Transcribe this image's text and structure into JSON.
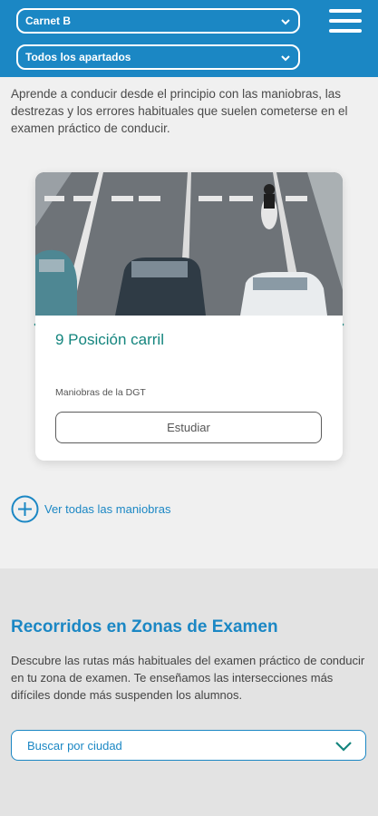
{
  "header": {
    "license_select": "Carnet B",
    "section_select": "Todos los apartados"
  },
  "intro_text": "Aprende a conducir desde el principio con las maniobras, las destrezas y los errores habituales que suelen cometerse en el examen práctico de conducir.",
  "card": {
    "title": "9 Posición carril",
    "category": "Maniobras de la DGT",
    "button_label": "Estudiar"
  },
  "see_all_label": "Ver todas las maniobras",
  "exam_routes": {
    "title": "Recorridos en Zonas de Examen",
    "description": "Descubre las rutas más habituales del examen práctico de conducir en tu zona de examen. Te enseñamos las intersecciones más difíciles donde más suspenden los alumnos.",
    "city_select": "Buscar por ciudad"
  },
  "colors": {
    "brand_blue": "#1b87c4",
    "accent_teal": "#14857e",
    "background": "#f0f0f0"
  },
  "icons": [
    "chevron-down-icon",
    "hamburger-menu-icon",
    "chevron-left-icon",
    "chevron-right-icon",
    "plus-circle-icon"
  ]
}
